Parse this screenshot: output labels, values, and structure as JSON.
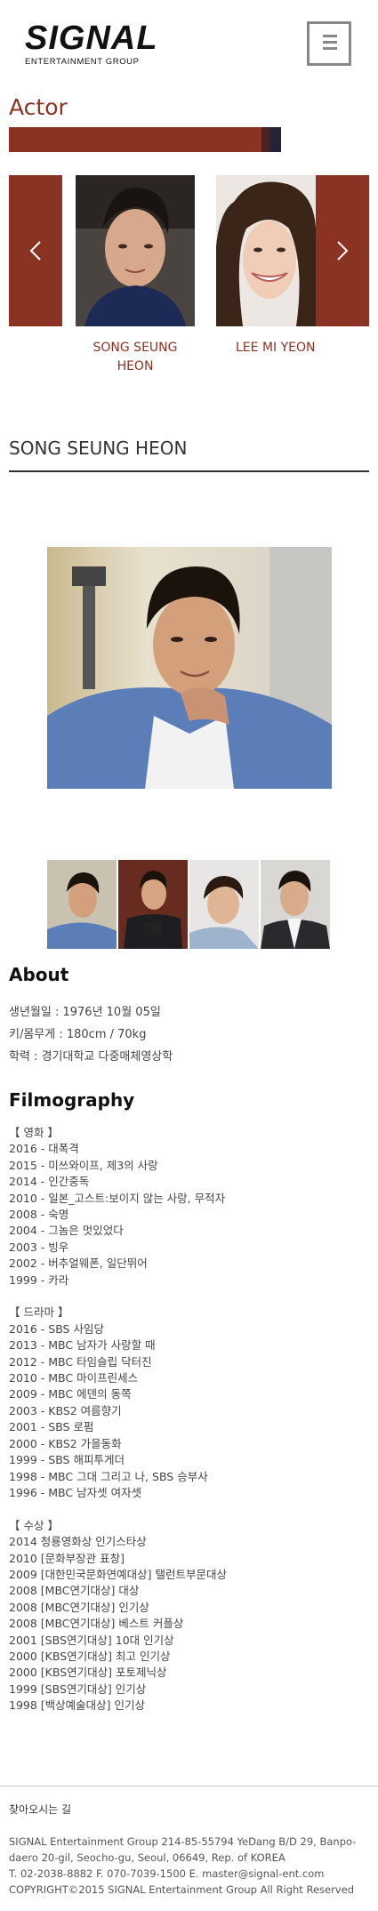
{
  "header": {
    "logo_main": "SIGNAL",
    "logo_sub": "ENTERTAINMENT GROUP",
    "menu_icon": "hamburger-menu-icon"
  },
  "section": {
    "title": "Actor",
    "accent_color": "#8b3322"
  },
  "slider": {
    "prev_icon": "chevron-left-icon",
    "next_icon": "chevron-right-icon",
    "actors": [
      {
        "name": "SONG SEUNG HEON"
      },
      {
        "name": "LEE MI YEON"
      }
    ]
  },
  "profile": {
    "name": "SONG SEUNG HEON"
  },
  "about": {
    "heading": "About",
    "lines": [
      "생년월일 : 1976년 10월 05일",
      "키/몸무게 : 180cm / 70kg",
      "학력 : 경기대학교 다중매체영상학"
    ]
  },
  "filmography": {
    "heading": "Filmography",
    "groups": [
      {
        "label": "【 영화 】",
        "items": [
          "2016 - 대폭격",
          "2015 - 미쓰와이프, 제3의 사랑",
          "2014 - 인간중독",
          "2010 - 일본_고스트:보이지 않는 사랑, 무적자",
          "2008 - 숙명",
          "2004 - 그놈은 멋있었다",
          "2003 - 빙우",
          "2002 - 버추얼웨폰, 일단뛰어",
          "1999 - 카라"
        ]
      },
      {
        "label": "【 드라마 】",
        "items": [
          "2016 - SBS 사임당",
          "2013 - MBC 남자가 사랑할 때",
          "2012 - MBC 타임슬립 닥터진",
          "2010 - MBC 마이프린세스",
          "2009 - MBC 에덴의 동쪽",
          "2003 - KBS2 여름향기",
          "2001 - SBS 로펌",
          "2000 - KBS2 가을동화",
          "1999 - SBS 해피투게더",
          "1998 - MBC 그대 그리고 나, SBS 승부사",
          "1996 - MBC 남자셋 여자셋"
        ]
      },
      {
        "label": "【 수상 】",
        "items": [
          "2014 청룡영화상 인기스타상",
          "2010 [문화부장관 표창]",
          "2009 [대한민국문화연예대상] 탤런트부문대상",
          "2008 [MBC연기대상] 대상",
          "2008 [MBC연기대상] 인기상",
          "2008 [MBC연기대상] 베스트 커플상",
          "2001 [SBS연기대상] 10대 인기상",
          "2000 [KBS연기대상] 최고 인기상",
          "2000 [KBS연기대상] 포토제닉상",
          "1999 [SBS연기대상] 인기상",
          "1998 [백상예술대상] 인기상"
        ]
      }
    ]
  },
  "footer": {
    "title": "찾아오시는 길",
    "address_1": "SIGNAL Entertainment Group 214-85-55794 YeDang B/D 29, Banpo-",
    "address_2": "daero 20-gil, Seocho-gu, Seoul, 06649, Rep. of KOREA",
    "contact": "T. 02-2038-8882 F. 070-7039-1500 E. master@signal-ent.com",
    "copyright": "COPYRIGHT©2015 SIGNAL Entertainment Group All Right Reserved"
  }
}
